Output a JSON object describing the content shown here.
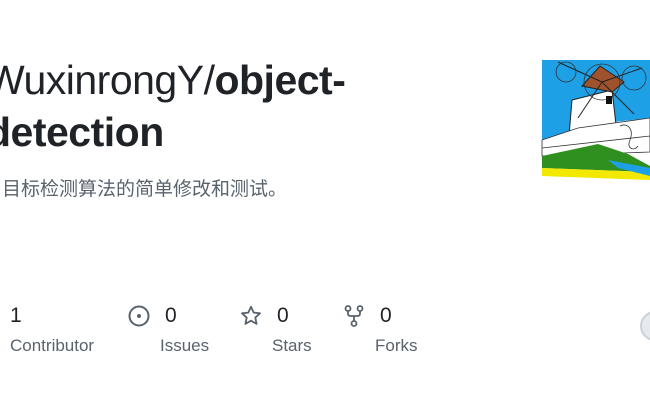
{
  "repo": {
    "owner": "WuxinrongY/",
    "name_line1": "object-",
    "name_line2": "detection",
    "description": "目标检测算法的简单修改和测试。"
  },
  "stats": [
    {
      "icon": "people-icon",
      "value": "1",
      "label": "Contributor"
    },
    {
      "icon": "issue-icon",
      "value": "0",
      "label": "Issues"
    },
    {
      "icon": "star-icon",
      "value": "0",
      "label": "Stars"
    },
    {
      "icon": "fork-icon",
      "value": "0",
      "label": "Forks"
    }
  ],
  "colors": {
    "text_primary": "#1f2328",
    "text_secondary": "#59636e",
    "thumb_sky": "#1ea0e6",
    "thumb_grass": "#2f8f1f",
    "thumb_sand": "#f2e800"
  }
}
